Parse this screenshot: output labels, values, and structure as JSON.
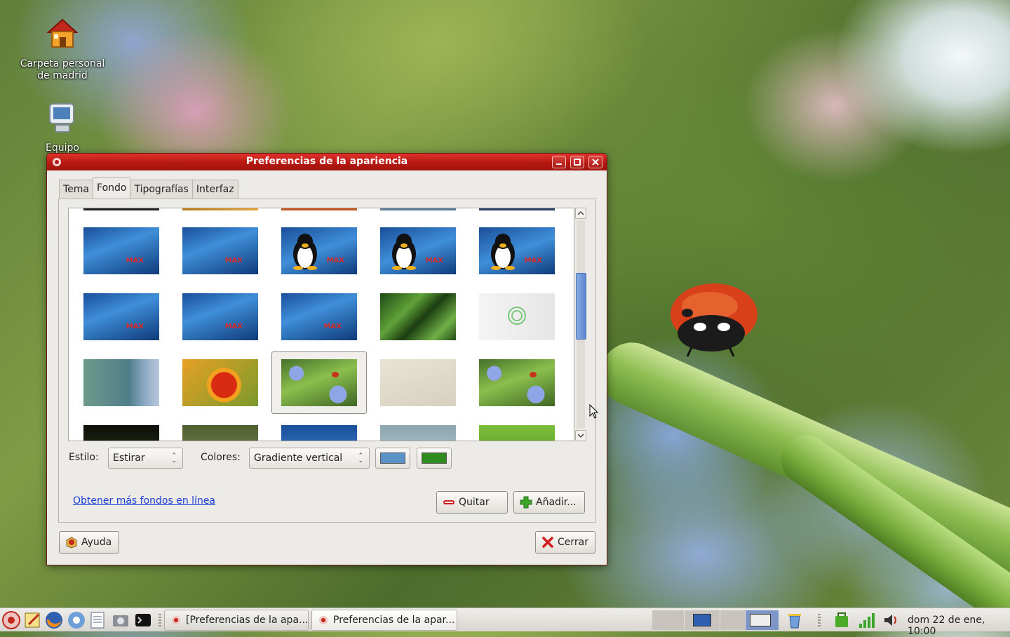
{
  "desktop": {
    "icons": [
      {
        "label": "Carpeta personal de madrid",
        "icon": "home-folder-icon"
      },
      {
        "label": "Equipo",
        "icon": "computer-icon"
      }
    ]
  },
  "window": {
    "title": "Preferencias de la apariencia",
    "tabs": [
      {
        "label": "Tema",
        "active": false
      },
      {
        "label": "Fondo",
        "active": true
      },
      {
        "label": "Tipografías",
        "active": false
      },
      {
        "label": "Interfaz",
        "active": false
      }
    ],
    "wallpapers": [
      "max-blue-1",
      "max-blue-2",
      "max-tux-1",
      "max-tux-2",
      "max-tux-3",
      "max-blue-3",
      "max-blue-4",
      "max-blue-5",
      "green-leaves",
      "white-logo",
      "teal-gradient",
      "red-flower",
      "ladybug-selected",
      "beige-texture",
      "ladybug-2"
    ],
    "selected_wallpaper": "ladybug-selected",
    "style": {
      "label": "Estilo:",
      "value": "Estirar"
    },
    "colors": {
      "label": "Colores:",
      "value": "Gradiente vertical",
      "primary": "#5b93c7",
      "secondary": "#2e8b1e"
    },
    "online_link": "Obtener más fondos en línea",
    "remove_button": "Quitar",
    "add_button": "Añadir...",
    "help_button": "Ayuda",
    "close_button": "Cerrar",
    "accent": "#b61912"
  },
  "taskbar": {
    "tasks": [
      {
        "label": "[Preferencias de la apa...",
        "active": false
      },
      {
        "label": "Preferencias de la apar...",
        "active": true
      }
    ],
    "clock": "dom 22 de ene, 10:00"
  }
}
